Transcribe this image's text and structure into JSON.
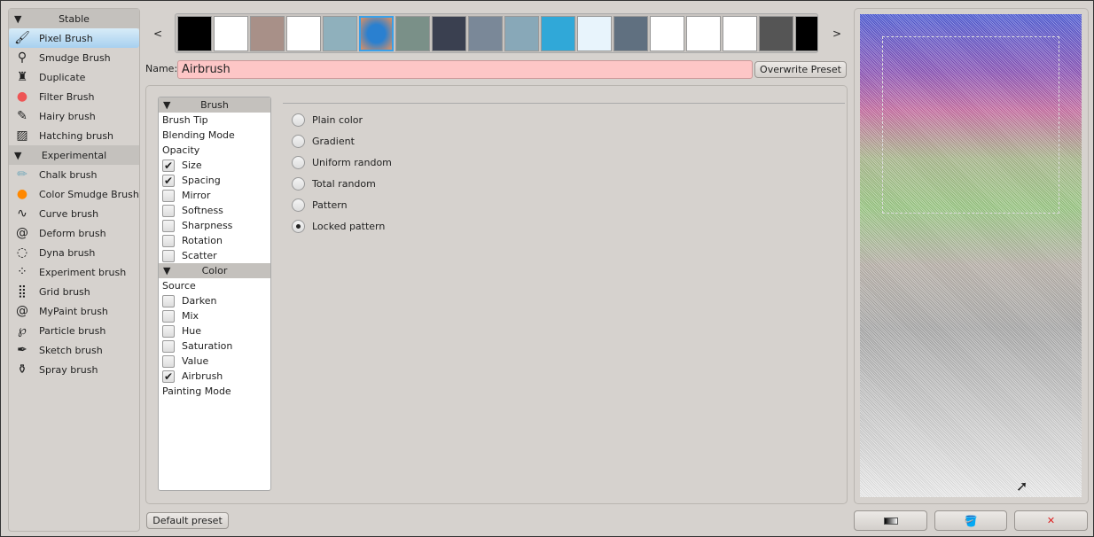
{
  "sidebar": {
    "groups": [
      {
        "label": "Stable",
        "items": [
          {
            "label": "Pixel Brush",
            "icon": "pixel-brush-icon",
            "selected": true
          },
          {
            "label": "Smudge Brush",
            "icon": "smudge-brush-icon"
          },
          {
            "label": "Duplicate",
            "icon": "stamp-icon"
          },
          {
            "label": "Filter Brush",
            "icon": "filter-brush-icon"
          },
          {
            "label": "Hairy brush",
            "icon": "hairy-brush-icon"
          },
          {
            "label": "Hatching brush",
            "icon": "hatching-brush-icon"
          }
        ]
      },
      {
        "label": "Experimental",
        "items": [
          {
            "label": "Chalk brush",
            "icon": "chalk-brush-icon"
          },
          {
            "label": "Color Smudge Brush",
            "icon": "color-smudge-icon"
          },
          {
            "label": "Curve brush",
            "icon": "curve-brush-icon"
          },
          {
            "label": "Deform brush",
            "icon": "deform-brush-icon"
          },
          {
            "label": "Dyna brush",
            "icon": "dyna-brush-icon"
          },
          {
            "label": "Experiment brush",
            "icon": "experiment-brush-icon"
          },
          {
            "label": "Grid brush",
            "icon": "grid-brush-icon"
          },
          {
            "label": "MyPaint brush",
            "icon": "mypaint-brush-icon"
          },
          {
            "label": "Particle brush",
            "icon": "particle-brush-icon"
          },
          {
            "label": "Sketch brush",
            "icon": "sketch-brush-icon"
          },
          {
            "label": "Spray brush",
            "icon": "spray-brush-icon"
          }
        ]
      }
    ]
  },
  "presets": {
    "prev": "<",
    "next": ">",
    "thumb_colors": [
      "#000",
      "#fff",
      "#a89088",
      "#fff",
      "#8fb0bc",
      "#2a80d0",
      "#7a9088",
      "#3a4050",
      "#7a8898",
      "#88a8b8",
      "#30a8d8",
      "#e8f4fc",
      "#607080",
      "#fff",
      "#fff",
      "#fff",
      "#555",
      "#000"
    ],
    "selected_index": 5
  },
  "name": {
    "label": "Name:",
    "value": "Airbrush"
  },
  "overwrite_label": "Overwrite Preset",
  "default_label": "Default preset",
  "options": {
    "brush_header": "Brush",
    "brush_items": [
      {
        "label": "Brush Tip"
      },
      {
        "label": "Blending Mode"
      },
      {
        "label": "Opacity"
      },
      {
        "label": "Size",
        "check": "✔"
      },
      {
        "label": "Spacing",
        "check": "✔"
      },
      {
        "label": "Mirror",
        "check": ""
      },
      {
        "label": "Softness",
        "check": ""
      },
      {
        "label": "Sharpness",
        "check": ""
      },
      {
        "label": "Rotation",
        "check": ""
      },
      {
        "label": "Scatter",
        "check": ""
      }
    ],
    "color_header": "Color",
    "color_items": [
      {
        "label": "Source"
      },
      {
        "label": "Darken",
        "check": ""
      },
      {
        "label": "Mix",
        "check": ""
      },
      {
        "label": "Hue",
        "check": ""
      },
      {
        "label": "Saturation",
        "check": ""
      },
      {
        "label": "Value",
        "check": ""
      },
      {
        "label": "Airbrush",
        "check": "✔"
      },
      {
        "label": "Painting Mode"
      }
    ]
  },
  "source_modes": [
    {
      "label": "Plain color"
    },
    {
      "label": "Gradient"
    },
    {
      "label": "Uniform random"
    },
    {
      "label": "Total random"
    },
    {
      "label": "Pattern"
    },
    {
      "label": "Locked pattern",
      "checked": true
    }
  ],
  "preview_buttons": [
    {
      "icon": "gradient-fill-icon"
    },
    {
      "icon": "paint-bucket-icon"
    },
    {
      "icon": "clear-broom-icon"
    }
  ]
}
